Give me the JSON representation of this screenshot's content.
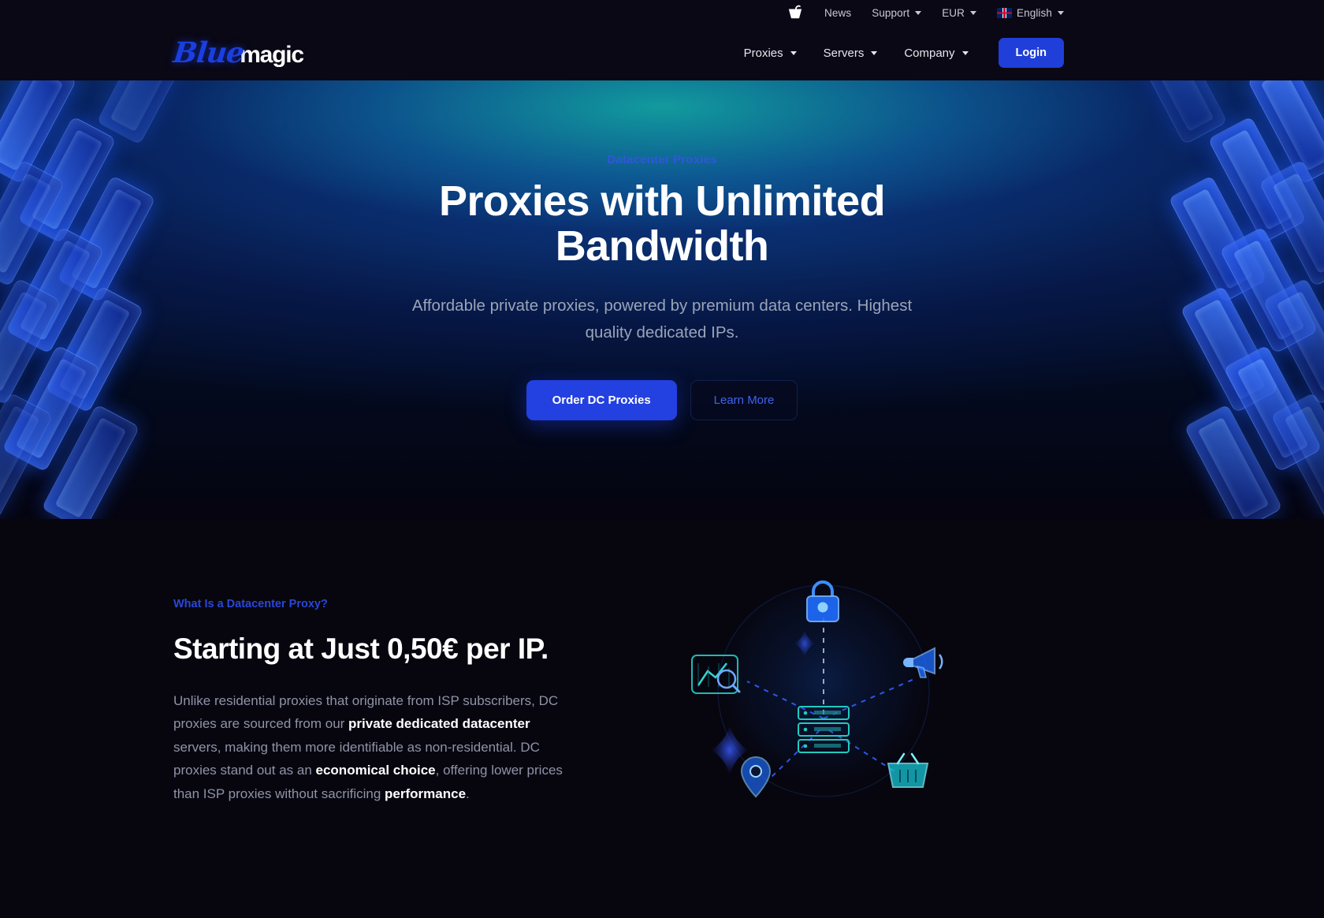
{
  "topbar": {
    "cart_icon": "shopping-cart-icon",
    "items": [
      {
        "label": "News",
        "has_caret": false
      },
      {
        "label": "Support",
        "has_caret": true
      },
      {
        "label": "EUR",
        "has_caret": true
      },
      {
        "label": "English",
        "has_caret": true,
        "flag": "uk-flag-icon"
      }
    ]
  },
  "nav": {
    "logo": {
      "part1": "Blue",
      "part2": "magic"
    },
    "items": [
      {
        "label": "Proxies"
      },
      {
        "label": "Servers"
      },
      {
        "label": "Company"
      }
    ],
    "login_label": "Login"
  },
  "hero": {
    "eyebrow": "Datacenter Proxies",
    "title": "Proxies with Unlimited Bandwidth",
    "subtitle": "Affordable private proxies, powered by premium data centers. Highest quality dedicated IPs.",
    "primary_cta": "Order DC Proxies",
    "secondary_cta": "Learn More"
  },
  "feature": {
    "eyebrow": "What Is a Datacenter Proxy?",
    "title": "Starting at Just 0,50€ per IP.",
    "body": {
      "p1": "Unlike residential proxies that originate from ISP subscribers, DC proxies are sourced from our ",
      "b1": "private dedicated datacenter",
      "p2": " servers, making them more identifiable as non-residential. DC proxies stand out as an ",
      "b2": "economical choice",
      "p3": ", offering lower prices than ISP proxies without sacrificing ",
      "b3": "performance",
      "p4": "."
    },
    "illustration_nodes": [
      "lock-icon",
      "analytics-icon",
      "megaphone-icon",
      "server-rack-icon",
      "location-pin-icon",
      "shopping-basket-icon"
    ]
  },
  "colors": {
    "accent_blue": "#2340e0",
    "link_blue": "#3f63ef",
    "eyebrow_blue": "#3355dd",
    "page_bg": "#07060f",
    "nav_bg": "#0a0814",
    "muted_text": "#8e93a6"
  }
}
